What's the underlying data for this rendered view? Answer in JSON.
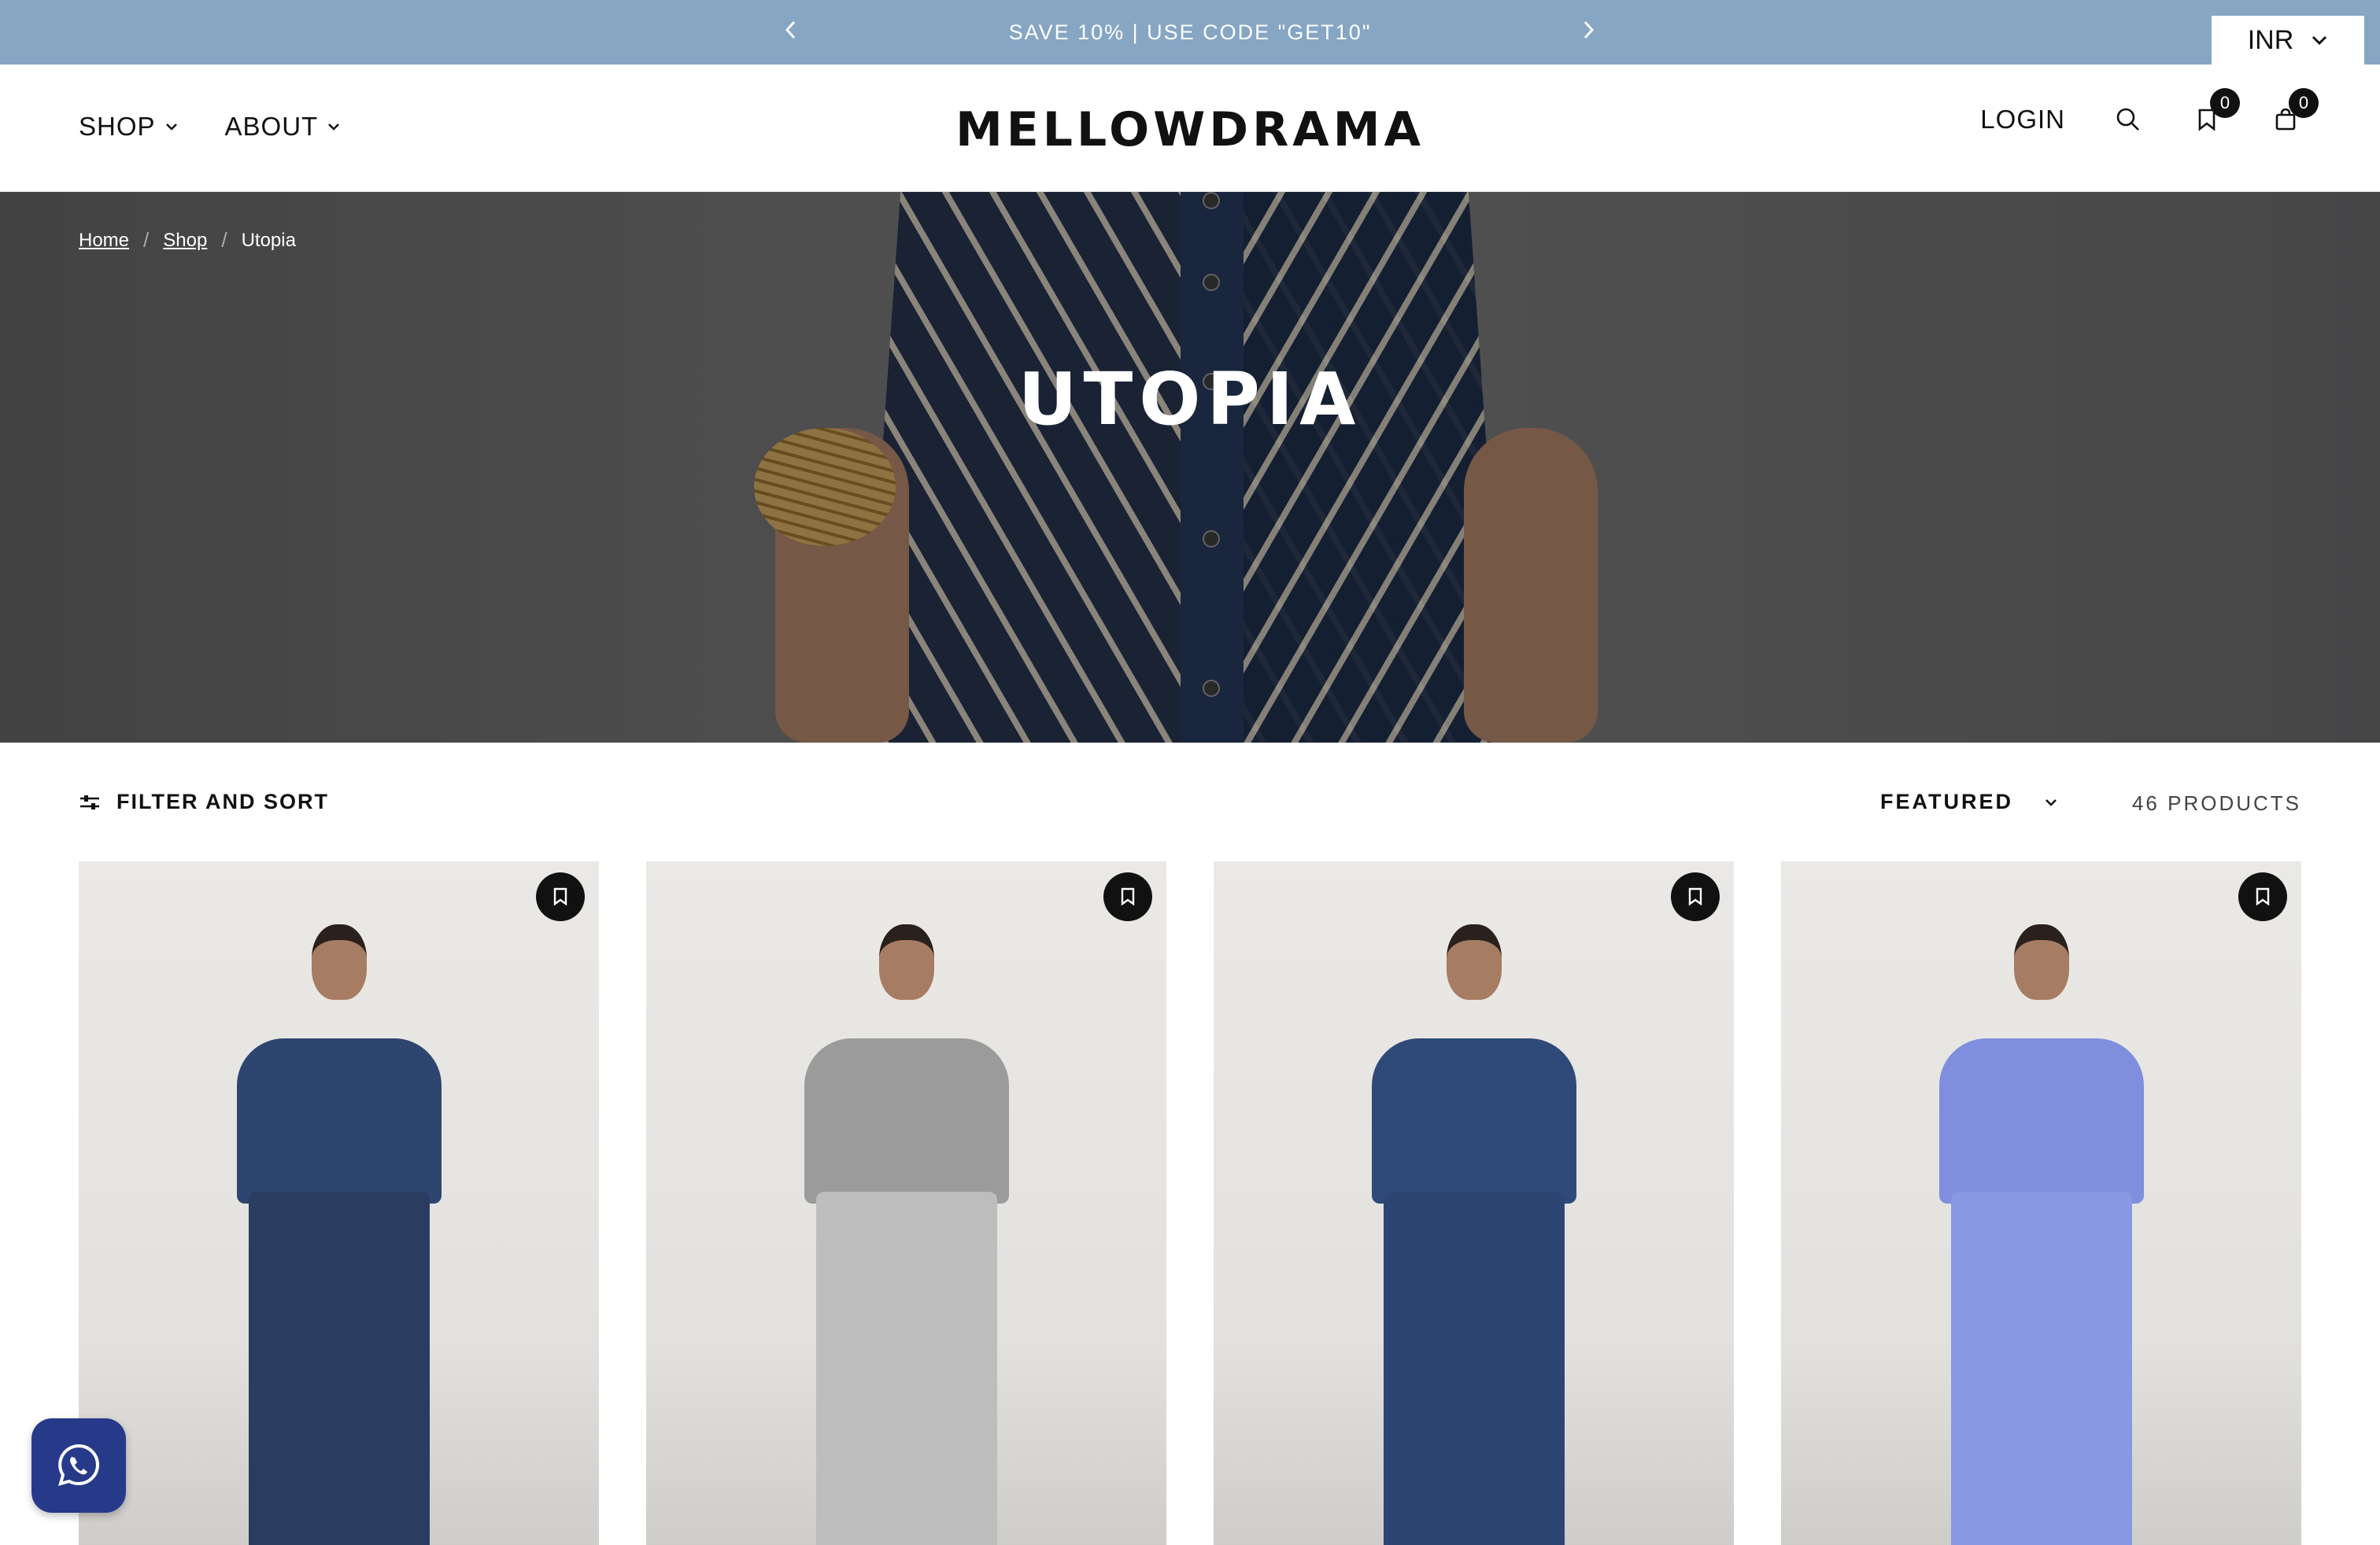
{
  "announcement": {
    "message": "SAVE 10% | USE CODE \"GET10\"",
    "prev_icon": "chevron-left-icon",
    "next_icon": "chevron-right-icon"
  },
  "currency": {
    "value": "INR"
  },
  "header": {
    "logo": "MELLOWDRAMA",
    "nav": [
      {
        "label": "SHOP"
      },
      {
        "label": "ABOUT"
      }
    ],
    "login": "LOGIN",
    "wishlist_count": "0",
    "cart_count": "0"
  },
  "breadcrumb": {
    "home": "Home",
    "shop": "Shop",
    "current": "Utopia"
  },
  "hero": {
    "title": "UTOPIA"
  },
  "toolbar": {
    "filter_label": "FILTER AND SORT",
    "sort_value": "FEATURED",
    "product_count": "46 PRODUCTS"
  },
  "products": [
    {
      "top_color": "#2e4570",
      "bottom_color": "#2a3c60",
      "icon": "bookmark-icon"
    },
    {
      "top_color": "#9b9b9b",
      "bottom_color": "#bdbdbd",
      "icon": "bookmark-icon"
    },
    {
      "top_color": "#2f4a78",
      "bottom_color": "#2d4573",
      "icon": "bookmark-icon"
    },
    {
      "top_color": "#7f8fde",
      "bottom_color": "#8898e3",
      "icon": "bookmark-icon"
    }
  ],
  "colors": {
    "announcement_bg": "#86a6c4",
    "whatsapp_bg": "#273a8a"
  }
}
